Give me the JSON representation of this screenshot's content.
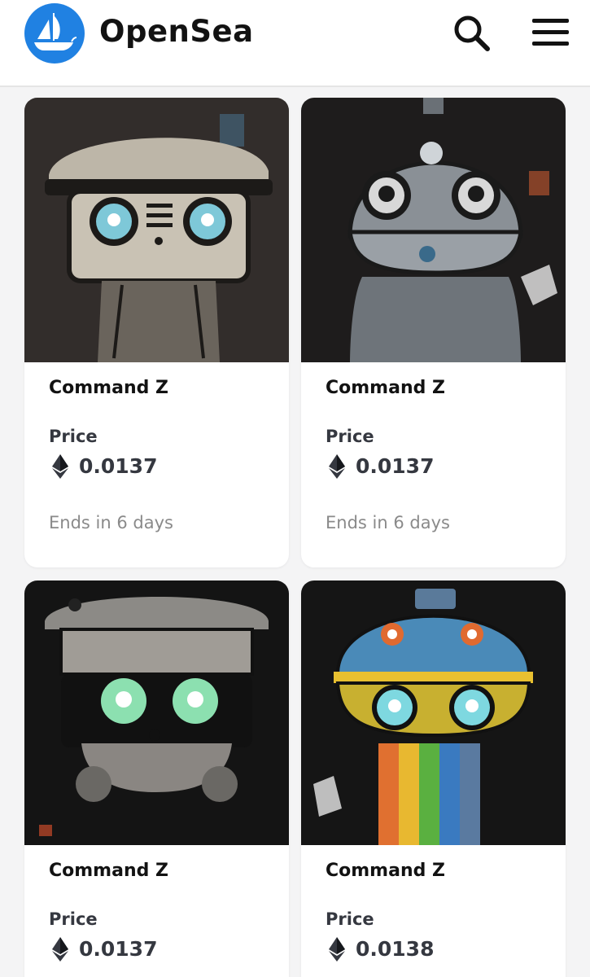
{
  "header": {
    "brand": "OpenSea",
    "logo_icon": "opensea-boat-icon",
    "search_icon": "search-icon",
    "menu_icon": "hamburger-menu-icon"
  },
  "colors": {
    "brand_blue": "#2081e2",
    "text_dark": "#121212",
    "text_muted": "#8a8a8a",
    "background": "#f4f4f5"
  },
  "listings": [
    {
      "name": "Command Z",
      "price_label": "Price",
      "price": "0.0137",
      "currency_icon": "ethereum-icon",
      "ends": "Ends in 6 days",
      "art_colors": [
        "#3a3532",
        "#bdb6a8",
        "#7ec8d8"
      ]
    },
    {
      "name": "Command Z",
      "price_label": "Price",
      "price": "0.0137",
      "currency_icon": "ethereum-icon",
      "ends": "Ends in 6 days",
      "art_colors": [
        "#1e1c1c",
        "#8a9096",
        "#d8d8d8"
      ]
    },
    {
      "name": "Command Z",
      "price_label": "Price",
      "price": "0.0137",
      "currency_icon": "ethereum-icon",
      "art_colors": [
        "#141414",
        "#8c8a86",
        "#8ce0b0"
      ]
    },
    {
      "name": "Command Z",
      "price_label": "Price",
      "price": "0.0138",
      "currency_icon": "ethereum-icon",
      "art_colors": [
        "#151515",
        "#4a8ab8",
        "#7ed8e0"
      ]
    }
  ]
}
